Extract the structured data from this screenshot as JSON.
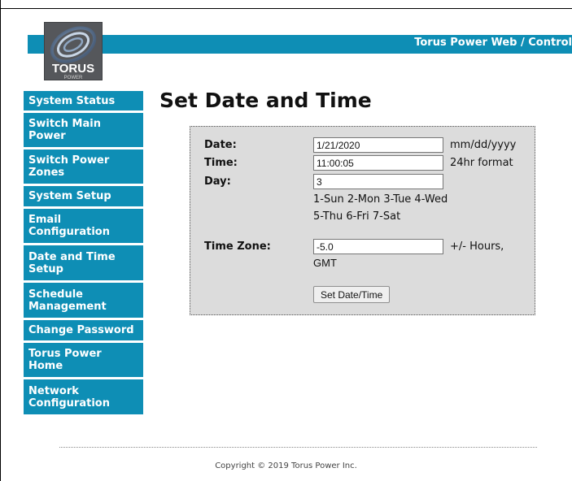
{
  "header": {
    "title": "Torus Power Web / Control"
  },
  "logo": {
    "text": "TORUS",
    "subtext": "POWER"
  },
  "sidebar": {
    "items": [
      {
        "label": "System Status"
      },
      {
        "label": "Switch Main Power"
      },
      {
        "label": "Switch Power Zones"
      },
      {
        "label": "System Setup"
      },
      {
        "label": "Email Configuration"
      },
      {
        "label": "Date and Time Setup"
      },
      {
        "label": "Schedule Management"
      },
      {
        "label": "Change Password"
      },
      {
        "label": "Torus Power Home"
      },
      {
        "label": "Network Configuration"
      }
    ]
  },
  "main": {
    "title": "Set Date and Time",
    "form": {
      "date_label": "Date:",
      "date_value": "1/21/2020",
      "date_hint": "mm/dd/yyyy",
      "time_label": "Time:",
      "time_value": "11:00:05",
      "time_hint": "24hr format",
      "day_label": "Day:",
      "day_value": "3",
      "day_hint_line1": "1-Sun 2-Mon 3-Tue 4-Wed",
      "day_hint_line2": "5-Thu 6-Fri 7-Sat",
      "tz_label": "Time Zone:",
      "tz_value": "-5.0",
      "tz_hint": "+/- Hours,",
      "tz_hint2": "GMT",
      "submit_label": "Set Date/Time"
    }
  },
  "footer": {
    "copyright": "Copyright © 2019 Torus Power Inc."
  },
  "colors": {
    "accent": "#0e8eb5",
    "panel": "#dcdcdc"
  }
}
